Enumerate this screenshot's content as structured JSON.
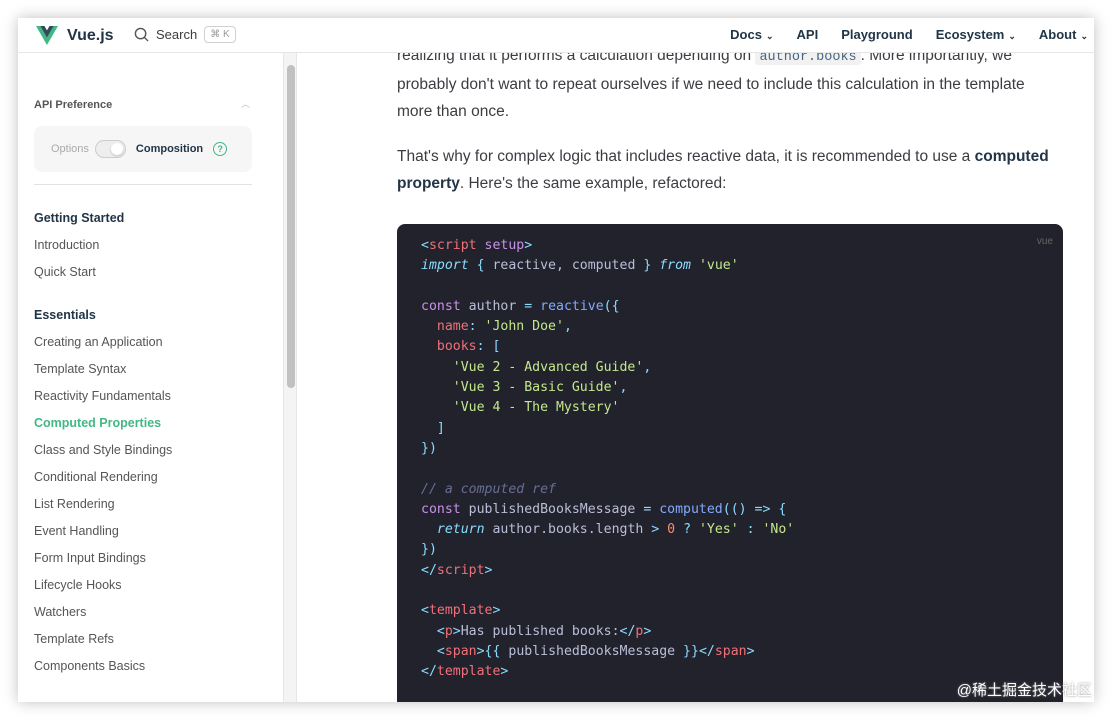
{
  "header": {
    "brand": "Vue.js",
    "search_label": "Search",
    "search_shortcut": "⌘ K",
    "nav": [
      {
        "label": "Docs",
        "dropdown": true
      },
      {
        "label": "API",
        "dropdown": false
      },
      {
        "label": "Playground",
        "dropdown": false
      },
      {
        "label": "Ecosystem",
        "dropdown": true
      },
      {
        "label": "About",
        "dropdown": true
      }
    ]
  },
  "sidebar": {
    "api_preference": {
      "label": "API Preference",
      "options_label": "Options",
      "composition_label": "Composition",
      "help": "?"
    },
    "sections": [
      {
        "title": "Getting Started",
        "items": [
          "Introduction",
          "Quick Start"
        ]
      },
      {
        "title": "Essentials",
        "items": [
          "Creating an Application",
          "Template Syntax",
          "Reactivity Fundamentals",
          "Computed Properties",
          "Class and Style Bindings",
          "Conditional Rendering",
          "List Rendering",
          "Event Handling",
          "Form Input Bindings",
          "Lifecycle Hooks",
          "Watchers",
          "Template Refs",
          "Components Basics"
        ]
      }
    ],
    "active_item": "Computed Properties"
  },
  "content": {
    "p1_a": "realizing that it performs a calculation depending on ",
    "p1_code": "author.books",
    "p1_b": ". More importantly, we probably don't want to repeat ourselves if we need to include this calculation in the template more than once.",
    "p2_a": "That's why for complex logic that includes reactive data, it is recommended to use a ",
    "p2_bold": "computed property",
    "p2_b": ". Here's the same example, refactored:",
    "code_lang": "vue",
    "code": [
      [
        [
          "<",
          "punc"
        ],
        [
          "script",
          "tag"
        ],
        [
          " setup",
          "attr"
        ],
        [
          ">",
          "punc"
        ]
      ],
      [
        [
          "import",
          "it"
        ],
        [
          " { ",
          "punc"
        ],
        [
          "reactive, computed",
          "plain"
        ],
        [
          " } ",
          "punc"
        ],
        [
          "from",
          "it"
        ],
        [
          " ",
          "plain"
        ],
        [
          "'vue'",
          "str"
        ]
      ],
      [],
      [
        [
          "const",
          "kw"
        ],
        [
          " author ",
          "plain"
        ],
        [
          "=",
          "punc"
        ],
        [
          " ",
          "plain"
        ],
        [
          "reactive",
          "fn"
        ],
        [
          "({",
          "punc"
        ]
      ],
      [
        [
          "  name",
          "prop"
        ],
        [
          ": ",
          "punc"
        ],
        [
          "'John Doe'",
          "str"
        ],
        [
          ",",
          "punc"
        ]
      ],
      [
        [
          "  books",
          "prop"
        ],
        [
          ": [",
          "punc"
        ]
      ],
      [
        [
          "    'Vue 2 - Advanced Guide'",
          "str"
        ],
        [
          ",",
          "punc"
        ]
      ],
      [
        [
          "    'Vue 3 - Basic Guide'",
          "str"
        ],
        [
          ",",
          "punc"
        ]
      ],
      [
        [
          "    'Vue 4 - The Mystery'",
          "str"
        ]
      ],
      [
        [
          "  ]",
          "punc"
        ]
      ],
      [
        [
          "})",
          "punc"
        ]
      ],
      [],
      [
        [
          "// a computed ref",
          "com"
        ]
      ],
      [
        [
          "const",
          "kw"
        ],
        [
          " publishedBooksMessage ",
          "plain"
        ],
        [
          "=",
          "punc"
        ],
        [
          " ",
          "plain"
        ],
        [
          "computed",
          "fn"
        ],
        [
          "(() => {",
          "punc"
        ]
      ],
      [
        [
          "  return",
          "it"
        ],
        [
          " author.books.length ",
          "plain"
        ],
        [
          ">",
          "punc"
        ],
        [
          " ",
          "plain"
        ],
        [
          "0",
          "num"
        ],
        [
          " ? ",
          "punc"
        ],
        [
          "'Yes'",
          "str"
        ],
        [
          " : ",
          "punc"
        ],
        [
          "'No'",
          "str"
        ]
      ],
      [
        [
          "})",
          "punc"
        ]
      ],
      [
        [
          "</",
          "punc"
        ],
        [
          "script",
          "tag"
        ],
        [
          ">",
          "punc"
        ]
      ],
      [],
      [
        [
          "<",
          "punc"
        ],
        [
          "template",
          "tag"
        ],
        [
          ">",
          "punc"
        ]
      ],
      [
        [
          "  <",
          "punc"
        ],
        [
          "p",
          "tag"
        ],
        [
          ">",
          "punc"
        ],
        [
          "Has published books:",
          "plain"
        ],
        [
          "</",
          "punc"
        ],
        [
          "p",
          "tag"
        ],
        [
          ">",
          "punc"
        ]
      ],
      [
        [
          "  <",
          "punc"
        ],
        [
          "span",
          "tag"
        ],
        [
          ">",
          "punc"
        ],
        [
          "{{ ",
          "punc"
        ],
        [
          "publishedBooksMessage",
          "plain"
        ],
        [
          " }}",
          "punc"
        ],
        [
          "</",
          "punc"
        ],
        [
          "span",
          "tag"
        ],
        [
          ">",
          "punc"
        ]
      ],
      [
        [
          "</",
          "punc"
        ],
        [
          "template",
          "tag"
        ],
        [
          ">",
          "punc"
        ]
      ]
    ]
  },
  "watermark": "@稀土掘金技术社区",
  "colors": {
    "accent": "#42b883",
    "code_bg": "#22222c"
  }
}
